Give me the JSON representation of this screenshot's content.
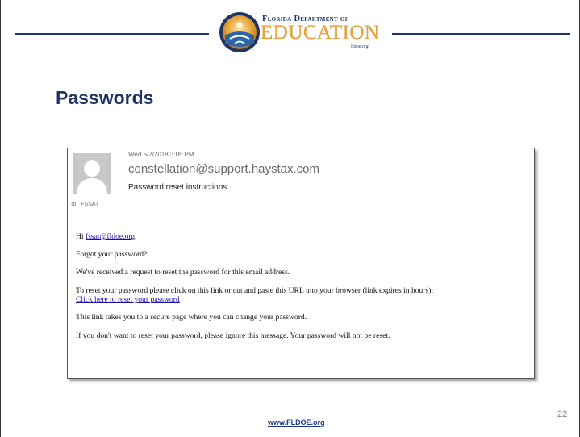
{
  "header": {
    "logo_line1": "Florida Department of",
    "logo_line2": "EDUCATION",
    "logo_line3": "fldoe.org"
  },
  "page_title": "Passwords",
  "email": {
    "date": "Wed 5/2/2018 3:05 PM",
    "from": "constellation@support.haystax.com",
    "subject": "Password reset instructions",
    "to_label": "To",
    "to_value": "FSSAT",
    "greeting_prefix": "Hi ",
    "greeting_email": "fssat@fldoe.org",
    "greeting_suffix": ",",
    "line_forgot": "Forgot your password?",
    "line_received": "We've received a request to reset the password for this email address.",
    "line_instructions": "To reset your password please click on this link or cut and paste this URL into your browser (link expires in hours):",
    "reset_link": "Click here to reset your password",
    "line_secure": "This link takes you to a secure page where you can change your password.",
    "line_ignore": "If you don't want to reset your password, please ignore this message. Your password will not be reset."
  },
  "footer": {
    "url": "www.FLDOE.org",
    "page_number": "22"
  },
  "colors": {
    "title": "#1f3566",
    "logo_gold": "#e8a33a",
    "link": "#1a0dab",
    "footer_line": "#c4a36a"
  },
  "icons": {
    "avatar": "person-silhouette-icon",
    "seal": "fldoe-seal-icon"
  }
}
